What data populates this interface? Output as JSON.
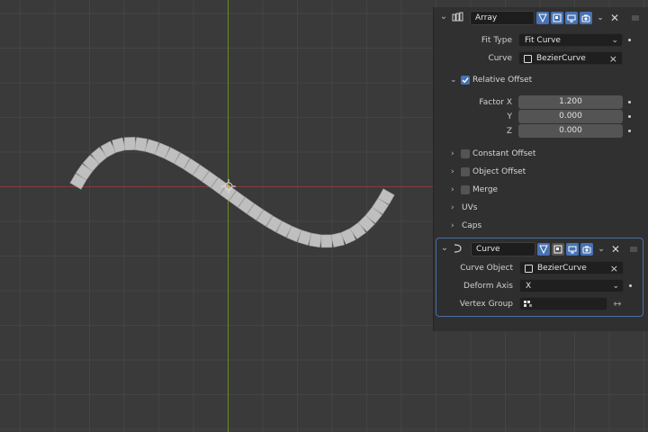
{
  "viewport": {
    "background": "#3a3a3a",
    "grid_color": "#444444",
    "x_axis_color": "#8a3a3a",
    "y_axis_color": "#6a8a2a",
    "block_color": "#bfbfbf"
  },
  "array_modifier": {
    "name": "Array",
    "fit_type_label": "Fit Type",
    "fit_type_value": "Fit Curve",
    "curve_label": "Curve",
    "curve_value": "BezierCurve",
    "relative_offset_label": "Relative Offset",
    "relative_offset_checked": true,
    "factor_x_label": "Factor X",
    "factor_x_value": "1.200",
    "y_label": "Y",
    "y_value": "0.000",
    "z_label": "Z",
    "z_value": "0.000",
    "constant_offset_label": "Constant Offset",
    "object_offset_label": "Object Offset",
    "merge_label": "Merge",
    "uvs_label": "UVs",
    "caps_label": "Caps"
  },
  "curve_modifier": {
    "name": "Curve",
    "curve_object_label": "Curve Object",
    "curve_object_value": "BezierCurve",
    "deform_axis_label": "Deform Axis",
    "deform_axis_value": "X",
    "vertex_group_label": "Vertex Group",
    "vertex_group_value": ""
  },
  "colors": {
    "accent": "#4772b3",
    "panel_bg": "#303030",
    "active_border": "#4a6ea6"
  }
}
